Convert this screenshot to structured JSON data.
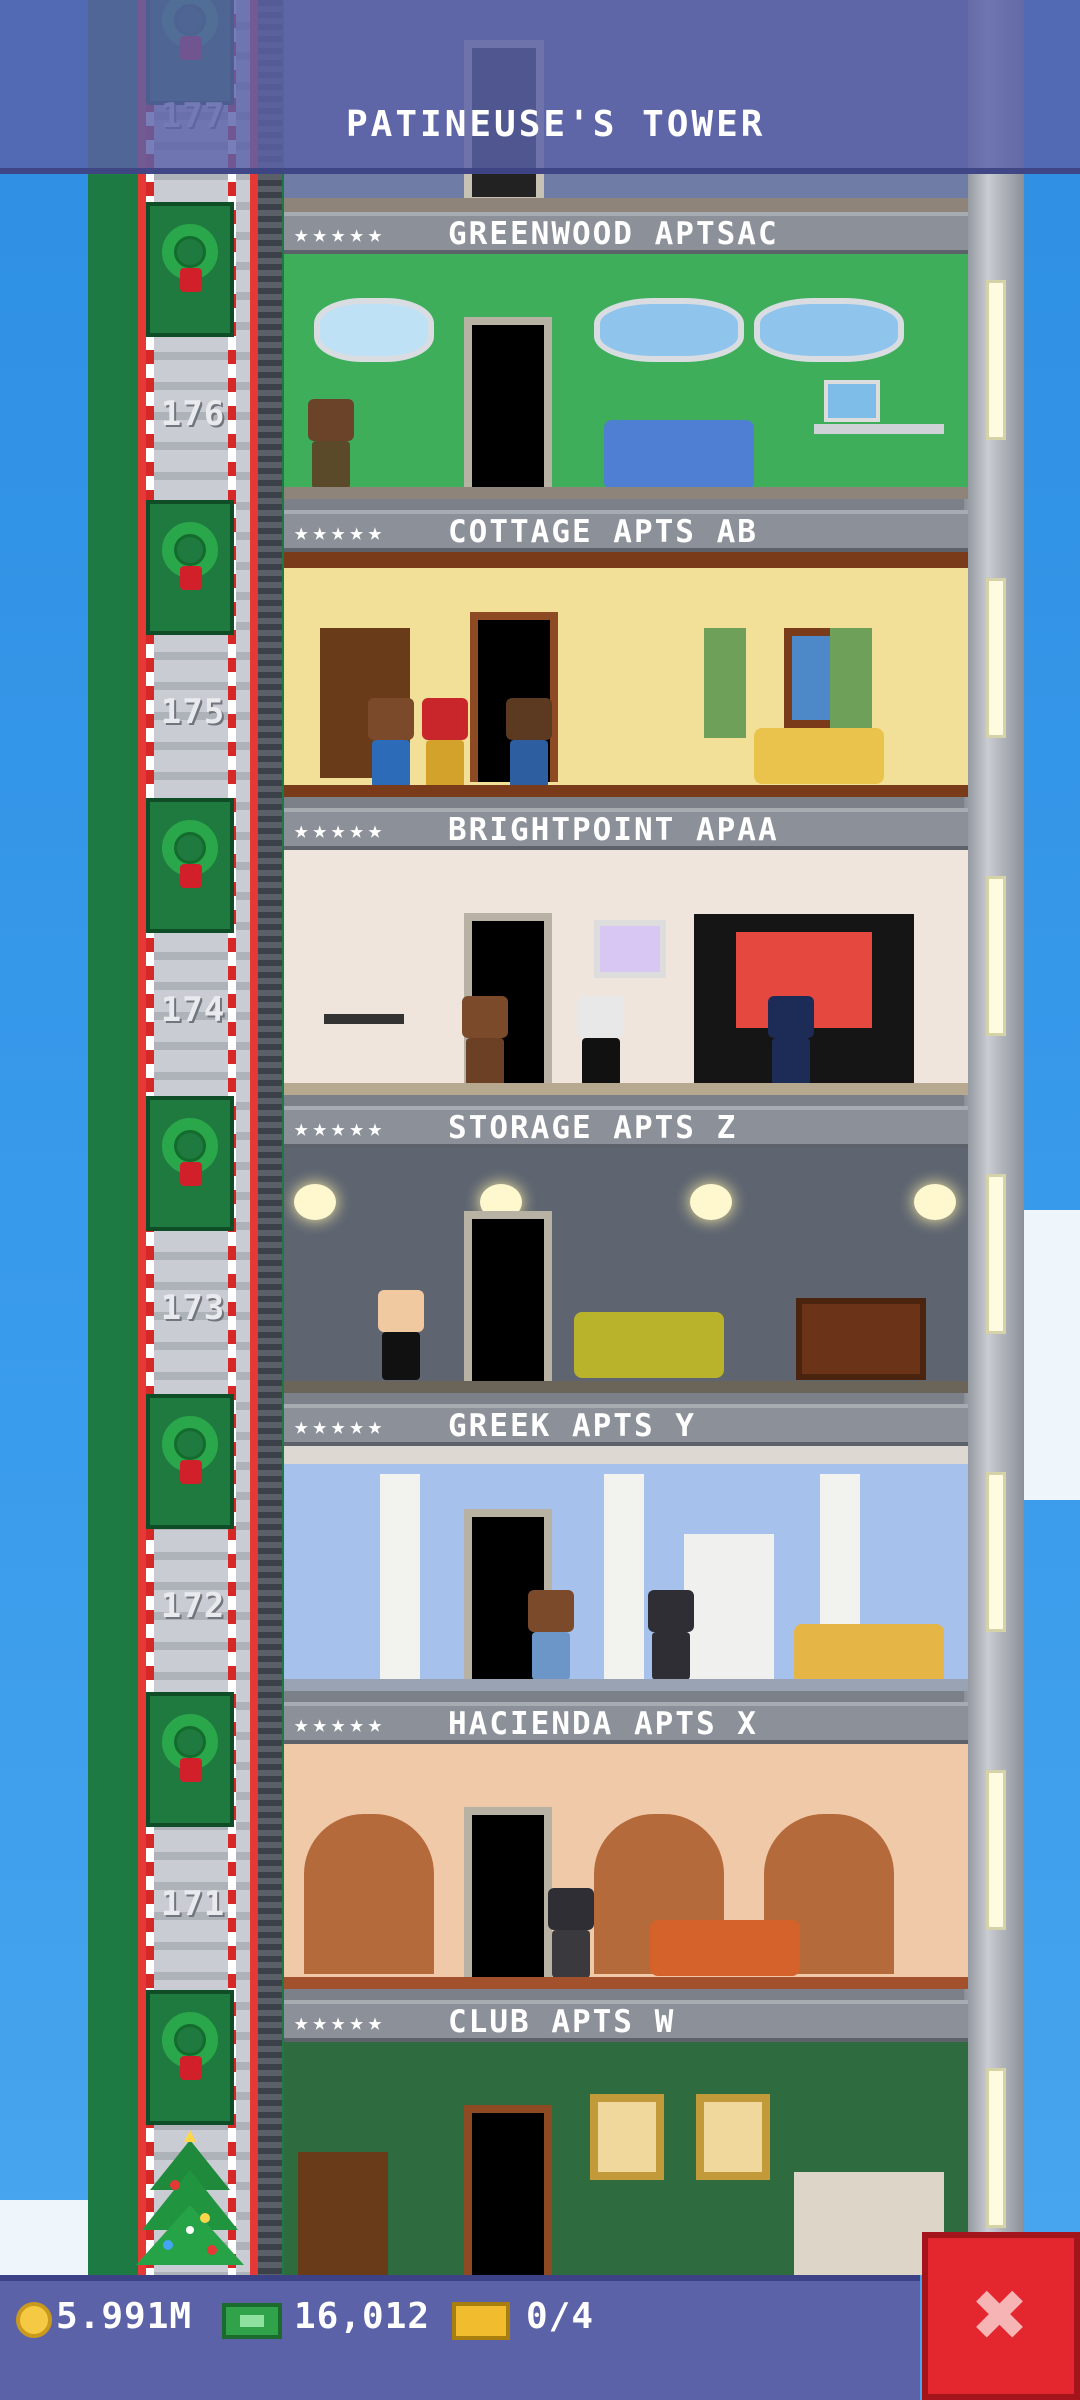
{
  "header": {
    "title": "PATINEUSE'S TOWER"
  },
  "elevator": {
    "floor_numbers": [
      "177",
      "176",
      "175",
      "174",
      "173",
      "172",
      "171"
    ]
  },
  "floors": [
    {
      "stars": "★★★★★",
      "name": "GREENWOOD APTSAC"
    },
    {
      "stars": "★★★★★",
      "name": "COTTAGE APTS AB"
    },
    {
      "stars": "★★★★★",
      "name": "BRIGHTPOINT APAA"
    },
    {
      "stars": "★★★★★",
      "name": "STORAGE APTS Z"
    },
    {
      "stars": "★★★★★",
      "name": "GREEK APTS Y"
    },
    {
      "stars": "★★★★★",
      "name": "HACIENDA APTS X"
    },
    {
      "stars": "★★★★★",
      "name": "CLUB APTS W"
    }
  ],
  "status_bar": {
    "coins": "5.991M",
    "bux": "16,012",
    "tickets": "0/4"
  },
  "icons": {
    "coin": "coin-icon",
    "bux": "bux-icon",
    "ticket": "ticket-icon",
    "close": "close-icon"
  },
  "close_label": "✖",
  "colors": {
    "close_button": "#e4262e",
    "status_bar": "#5c62a8",
    "sky": "#2f93e6"
  }
}
